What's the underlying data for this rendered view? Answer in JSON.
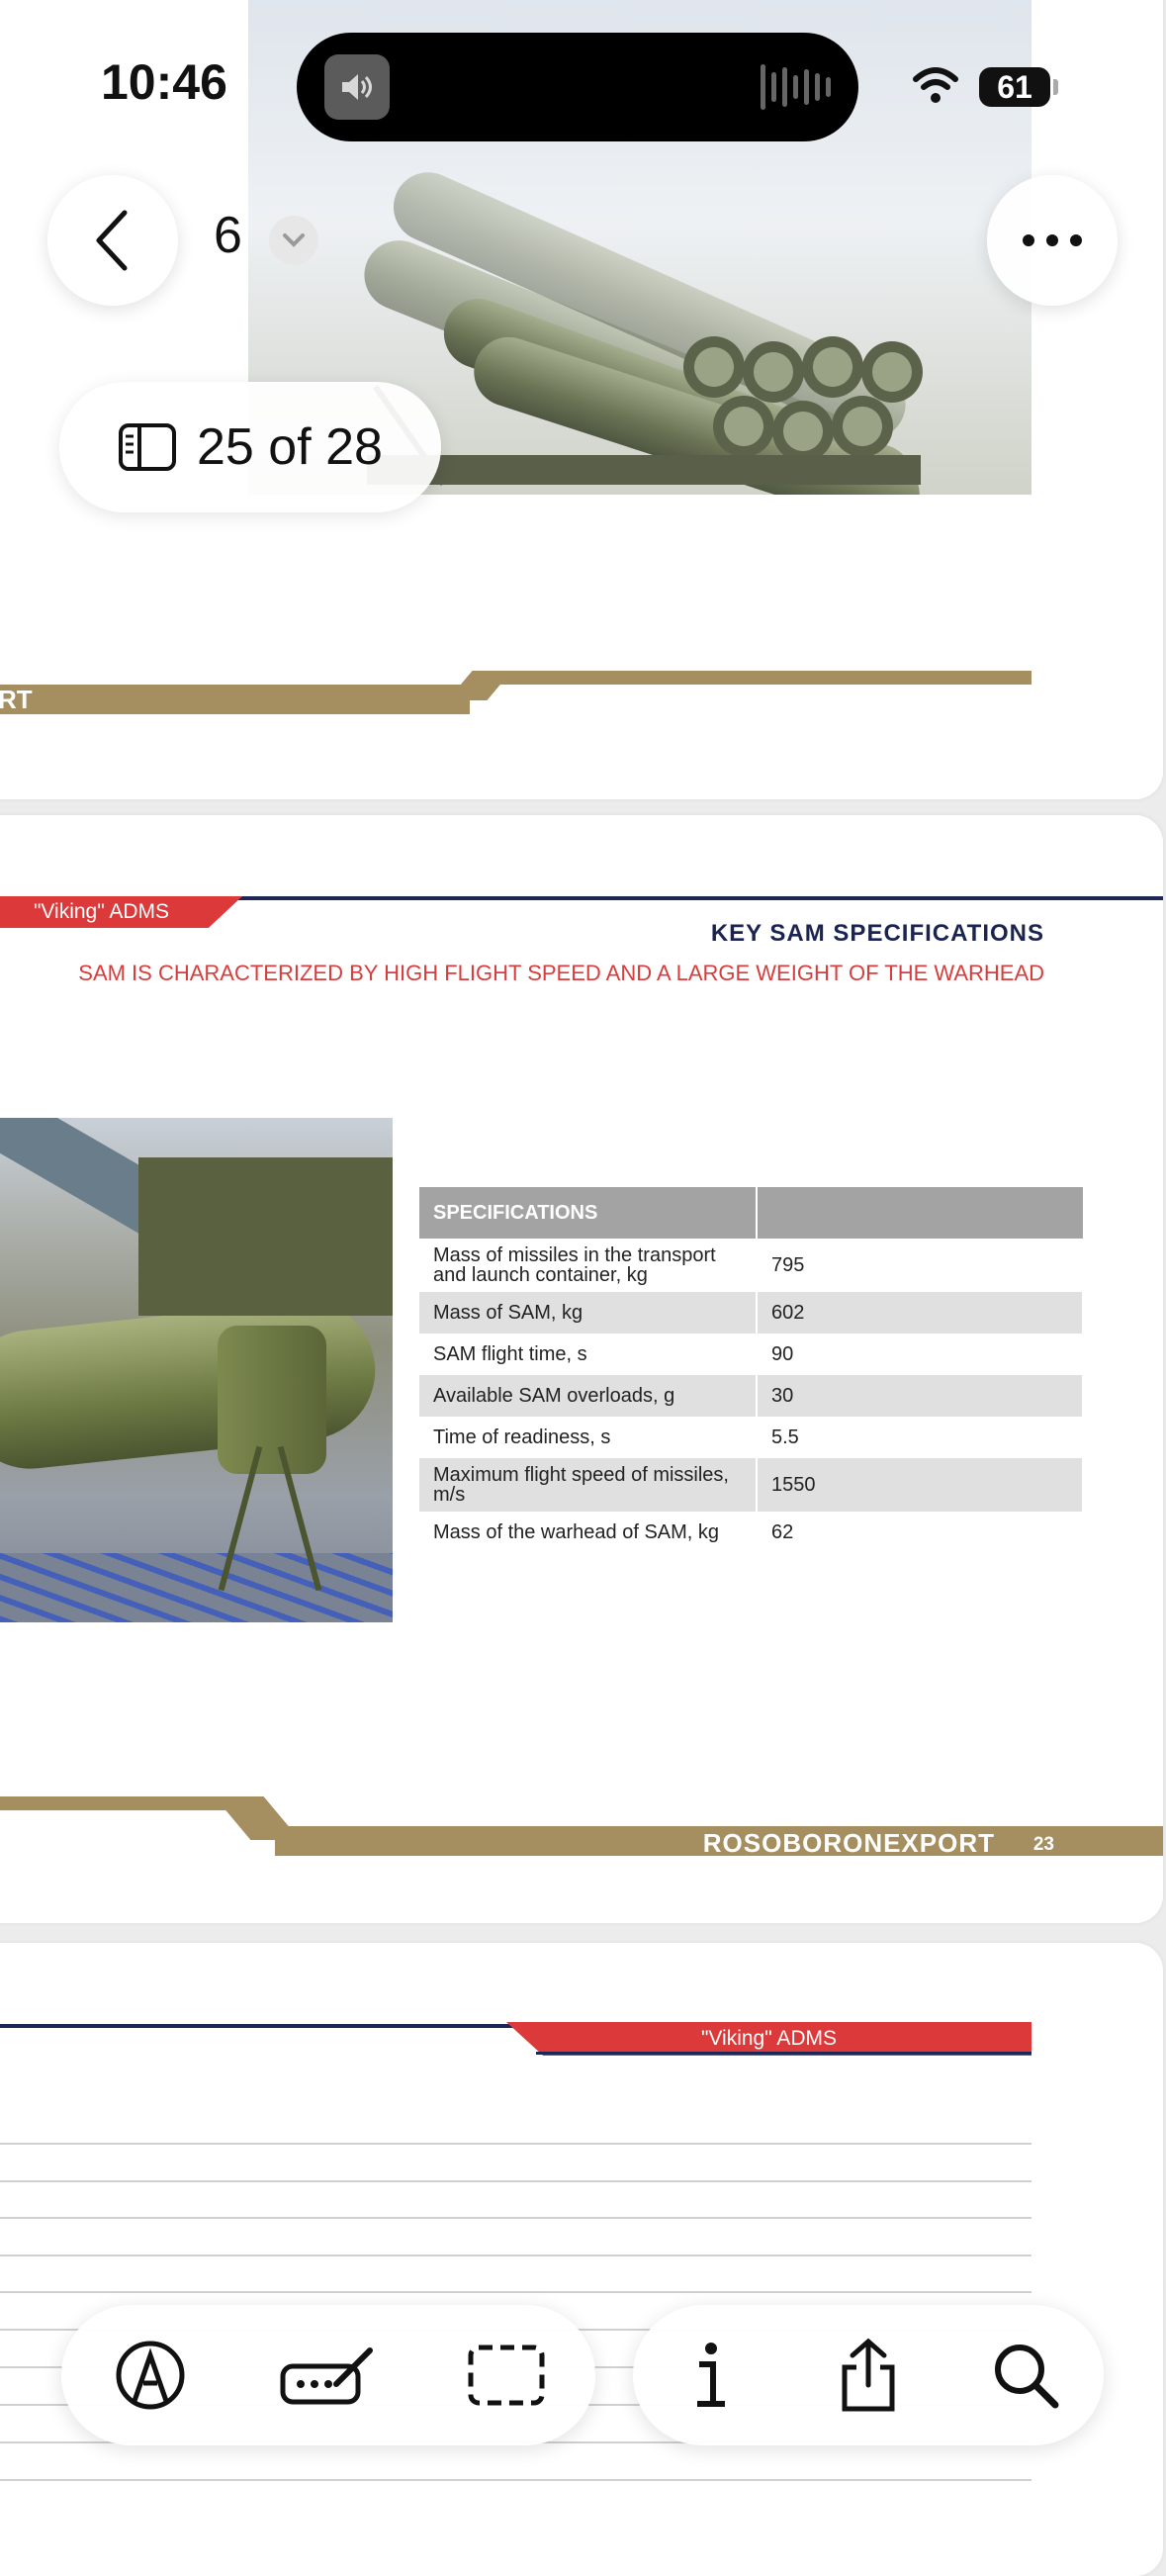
{
  "status_bar": {
    "time": "10:46",
    "battery": "61"
  },
  "nav": {
    "page_number": "6",
    "page_counter": "25 of 28"
  },
  "top_page": {
    "band_label": "RT"
  },
  "doc_page": {
    "tab_label": "\"Viking\" ADMS",
    "title": "KEY SAM SPECIFICATIONS",
    "subtitle": "SAM IS CHARACTERIZED BY HIGH FLIGHT SPEED AND A LARGE WEIGHT OF THE WARHEAD",
    "table": {
      "header": [
        "SPECIFICATIONS",
        ""
      ],
      "rows": [
        [
          "Mass of missiles in the transport and launch container, kg",
          "795"
        ],
        [
          "Mass of SAM, kg",
          "602"
        ],
        [
          "SAM flight time, s",
          "90"
        ],
        [
          "Available SAM overloads, g",
          "30"
        ],
        [
          "Time of readiness, s",
          "5.5"
        ],
        [
          "Maximum flight speed of missiles, m/s",
          "1550"
        ],
        [
          "Mass of the warhead of SAM, kg",
          "62"
        ]
      ]
    },
    "footer_brand": "ROSOBORONEXPORT",
    "footer_page": "23"
  },
  "next_page": {
    "tab_label": "\"Viking\" ADMS"
  },
  "toolbar": {
    "items": [
      "markup-icon",
      "autofill-icon",
      "select-region-icon",
      "info-icon",
      "share-icon",
      "search-icon"
    ]
  }
}
